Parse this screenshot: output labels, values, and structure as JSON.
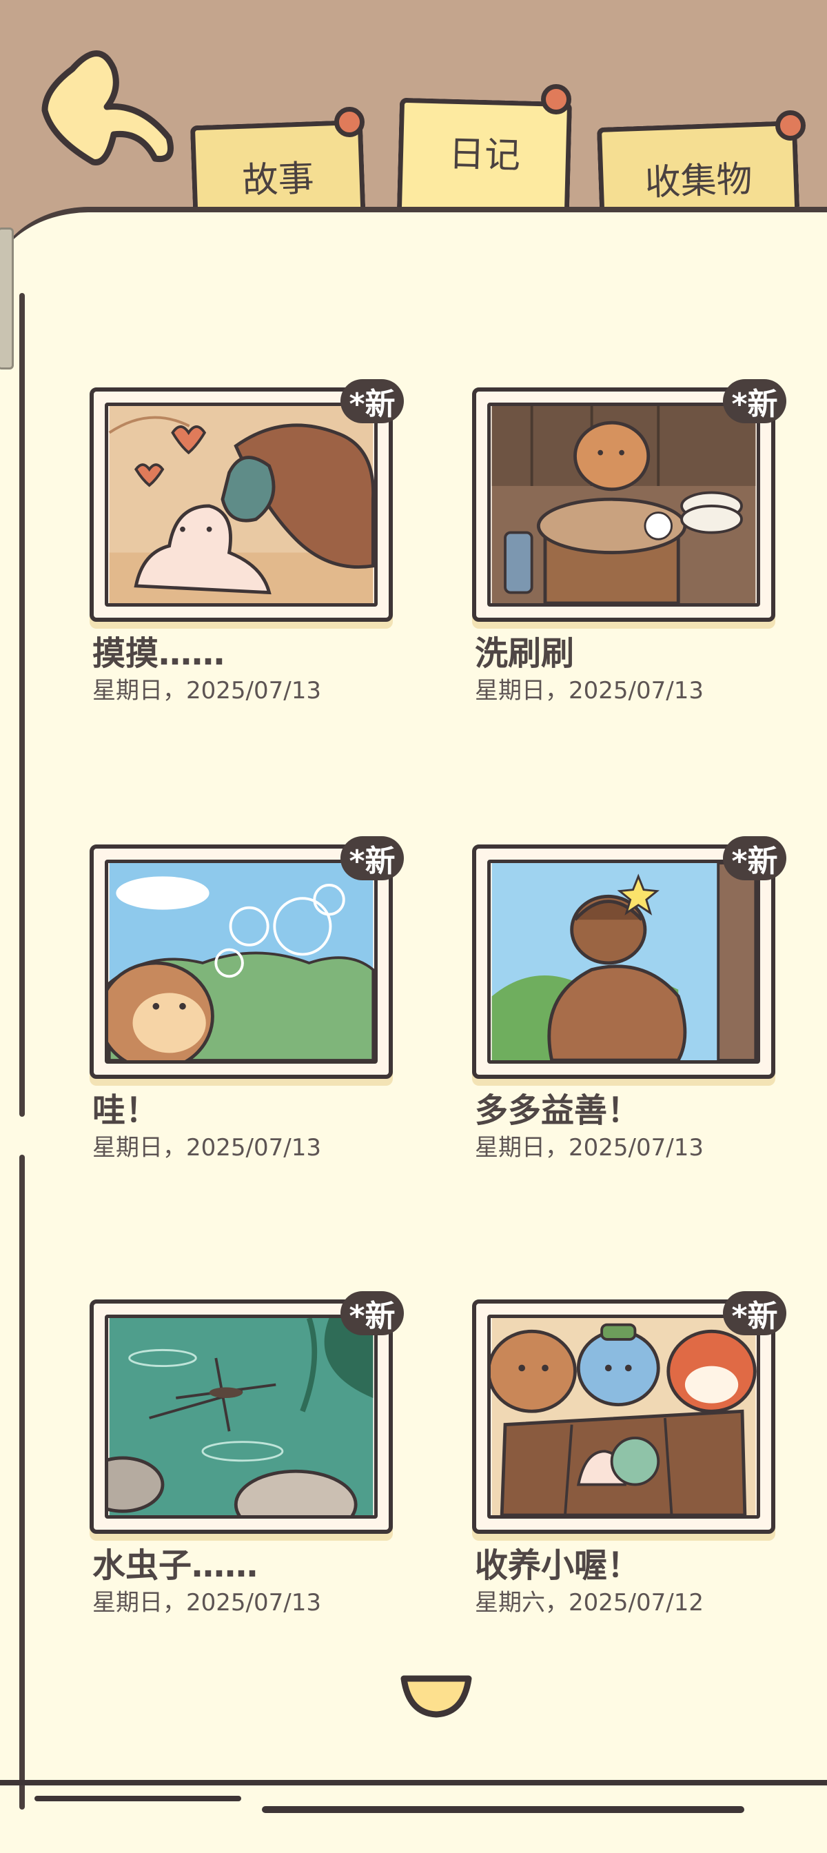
{
  "tabs": {
    "story": "故事",
    "diary": "日记",
    "collection": "收集物"
  },
  "badge_label": "*新",
  "entries": [
    {
      "title": "摸摸……",
      "date": "星期日，2025/07/13",
      "scene": "snail"
    },
    {
      "title": "洗刷刷",
      "date": "星期日，2025/07/13",
      "scene": "dishes"
    },
    {
      "title": "哇！",
      "date": "星期日，2025/07/13",
      "scene": "bubbles"
    },
    {
      "title": "多多益善！",
      "date": "星期日，2025/07/13",
      "scene": "acorn"
    },
    {
      "title": "水虫子……",
      "date": "星期日，2025/07/13",
      "scene": "pond"
    },
    {
      "title": "收养小喔！",
      "date": "星期六，2025/07/12",
      "scene": "friends"
    }
  ],
  "colors": {
    "header_bg": "#c4a58d",
    "page_bg": "#fffbe4",
    "tab_fill": "#f5de92",
    "pin": "#e07b5a",
    "outline": "#3e3536"
  },
  "icons": {
    "back": "back-arrow-icon",
    "down": "chevron-down-icon"
  }
}
